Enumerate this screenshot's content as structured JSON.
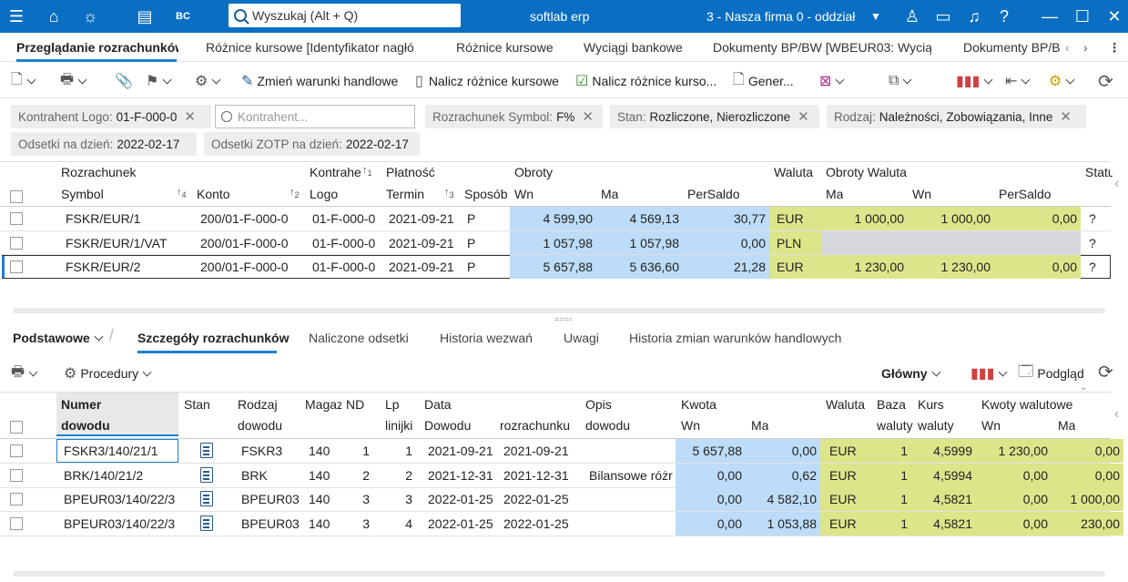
{
  "titlebar": {
    "search_placeholder": "Wyszukaj (Alt + Q)",
    "app_title": "softlab erp",
    "company": "3 - Nasza firma 0 - oddział"
  },
  "tabs": [
    {
      "label": "Przeglądanie rozrachunków"
    },
    {
      "label": "Różnice kursowe [Identyfikator nagłó"
    },
    {
      "label": "Różnice kursowe"
    },
    {
      "label": "Wyciągi bankowe"
    },
    {
      "label": "Dokumenty BP/BW [WBEUR03: Wycią"
    },
    {
      "label": "Dokumenty BP/B"
    }
  ],
  "toolbar": {
    "zmien": "Zmień warunki handlowe",
    "nalicz": "Nalicz różnice kursowe",
    "nalicz2": "Nalicz różnice kurso...",
    "gener": "Gener..."
  },
  "filters": {
    "kontrahent_label": "Kontrahent Logo:",
    "kontrahent_value": "01-F-000-0",
    "kontrahent_placeholder": "Kontrahent...",
    "rozrachunek_label": "Rozrachunek Symbol:",
    "rozrachunek_value": "F%",
    "stan_label": "Stan:",
    "stan_value": "Rozliczone, Nierozliczone",
    "rodzaj_label": "Rodzaj:",
    "rodzaj_value": "Należności, Zobowiązania, Inne",
    "odsetki_label": "Odsetki na dzień:",
    "odsetki_value": "2022-02-17",
    "zotp_label": "Odsetki ZOTP na dzień:",
    "zotp_value": "2022-02-17"
  },
  "top_headers": {
    "rozrachunek": "Rozrachunek",
    "kontrahent": "Kontrahent",
    "platnosc": "Płatność",
    "obroty": "Obroty",
    "waluta": "Waluta",
    "obroty_waluta": "Obroty Waluta",
    "status": "Statu",
    "symbol": "Symbol",
    "konto": "Konto",
    "logo": "Logo",
    "termin": "Termin",
    "sposob": "Sposób",
    "wn": "Wn",
    "ma": "Ma",
    "persaldo": "PerSaldo",
    "w_ma": "Ma",
    "w_wn": "Wn",
    "w_persaldo": "PerSaldo",
    "sort_symbol": "4",
    "sort_konto": "2",
    "sort_termin": "3",
    "sort_kontrahent": "1"
  },
  "top_rows": [
    {
      "symbol": "FSKR/EUR/1",
      "konto": "200/01-F-000-0",
      "logo": "01-F-000-0",
      "termin": "2021-09-21",
      "sposob": "P",
      "wn": "4 599,90",
      "ma": "4 569,13",
      "persaldo": "30,77",
      "waluta": "EUR",
      "w_ma": "1 000,00",
      "w_wn": "1 000,00",
      "w_persaldo": "0,00",
      "status": "?"
    },
    {
      "symbol": "FSKR/EUR/1/VAT",
      "konto": "200/01-F-000-0",
      "logo": "01-F-000-0",
      "termin": "2021-09-21",
      "sposob": "P",
      "wn": "1 057,98",
      "ma": "1 057,98",
      "persaldo": "0,00",
      "waluta": "PLN",
      "w_ma": "",
      "w_wn": "",
      "w_persaldo": "",
      "status": "?"
    },
    {
      "symbol": "FSKR/EUR/2",
      "konto": "200/01-F-000-0",
      "logo": "01-F-000-0",
      "termin": "2021-09-21",
      "sposob": "P",
      "wn": "5 657,88",
      "ma": "5 636,60",
      "persaldo": "21,28",
      "waluta": "EUR",
      "w_ma": "1 230,00",
      "w_wn": "1 230,00",
      "w_persaldo": "0,00",
      "status": "?"
    }
  ],
  "subtabs": {
    "podstawowe": "Podstawowe",
    "szczegoly": "Szczegóły rozrachunków",
    "odsetki": "Naliczone odsetki",
    "wezwan": "Historia wezwań",
    "uwagi": "Uwagi",
    "historia": "Historia zmian warunków handlowych"
  },
  "bottom_toolbar": {
    "procedury": "Procedury",
    "glowny": "Główny",
    "podglad": "Podgląd"
  },
  "bottom_headers": {
    "numer": "Numer",
    "dowodu": "dowodu",
    "stan": "Stan",
    "rodzaj": "Rodzaj",
    "rodzaj2": "dowodu",
    "magaz": "Magaz",
    "nd": "ND",
    "lp": "Lp",
    "linijki": "linijki",
    "data": "Data",
    "data_dowodu": "Dowodu",
    "data_rozr": "rozrachunku",
    "opis": "Opis",
    "opis2": "dowodu",
    "kwota": "Kwota",
    "wn": "Wn",
    "ma": "Ma",
    "waluta": "Waluta",
    "baza": "Baza",
    "baza2": "waluty",
    "kurs": "Kurs",
    "kurs2": "waluty",
    "kwoty_walutowe": "Kwoty walutowe",
    "kw_wn": "Wn",
    "kw_ma": "Ma"
  },
  "bottom_rows": [
    {
      "numer": "FSKR3/140/21/1",
      "rodzaj": "FSKR3",
      "magaz": "140",
      "nd": "1",
      "lp": "1",
      "data_dowodu": "2021-09-21",
      "data_rozr": "2021-09-21",
      "opis": "",
      "wn": "5 657,88",
      "ma": "0,00",
      "waluta": "EUR",
      "baza": "1",
      "kurs": "4,5999",
      "kw_wn": "1 230,00",
      "kw_ma": "0,00"
    },
    {
      "numer": "BRK/140/21/2",
      "rodzaj": "BRK",
      "magaz": "140",
      "nd": "2",
      "lp": "2",
      "data_dowodu": "2021-12-31",
      "data_rozr": "2021-12-31",
      "opis": "Bilansowe różr",
      "wn": "0,00",
      "ma": "0,62",
      "waluta": "EUR",
      "baza": "1",
      "kurs": "4,5994",
      "kw_wn": "0,00",
      "kw_ma": "0,00"
    },
    {
      "numer": "BPEUR03/140/22/3",
      "rodzaj": "BPEUR03",
      "magaz": "140",
      "nd": "3",
      "lp": "3",
      "data_dowodu": "2022-01-25",
      "data_rozr": "2022-01-25",
      "opis": "",
      "wn": "0,00",
      "ma": "4 582,10",
      "waluta": "EUR",
      "baza": "1",
      "kurs": "4,5821",
      "kw_wn": "0,00",
      "kw_ma": "1 000,00"
    },
    {
      "numer": "BPEUR03/140/22/3",
      "rodzaj": "BPEUR03",
      "magaz": "140",
      "nd": "3",
      "lp": "4",
      "data_dowodu": "2022-01-25",
      "data_rozr": "2022-01-25",
      "opis": "",
      "wn": "0,00",
      "ma": "1 053,88",
      "waluta": "EUR",
      "baza": "1",
      "kurs": "4,5821",
      "kw_wn": "0,00",
      "kw_ma": "230,00"
    }
  ]
}
